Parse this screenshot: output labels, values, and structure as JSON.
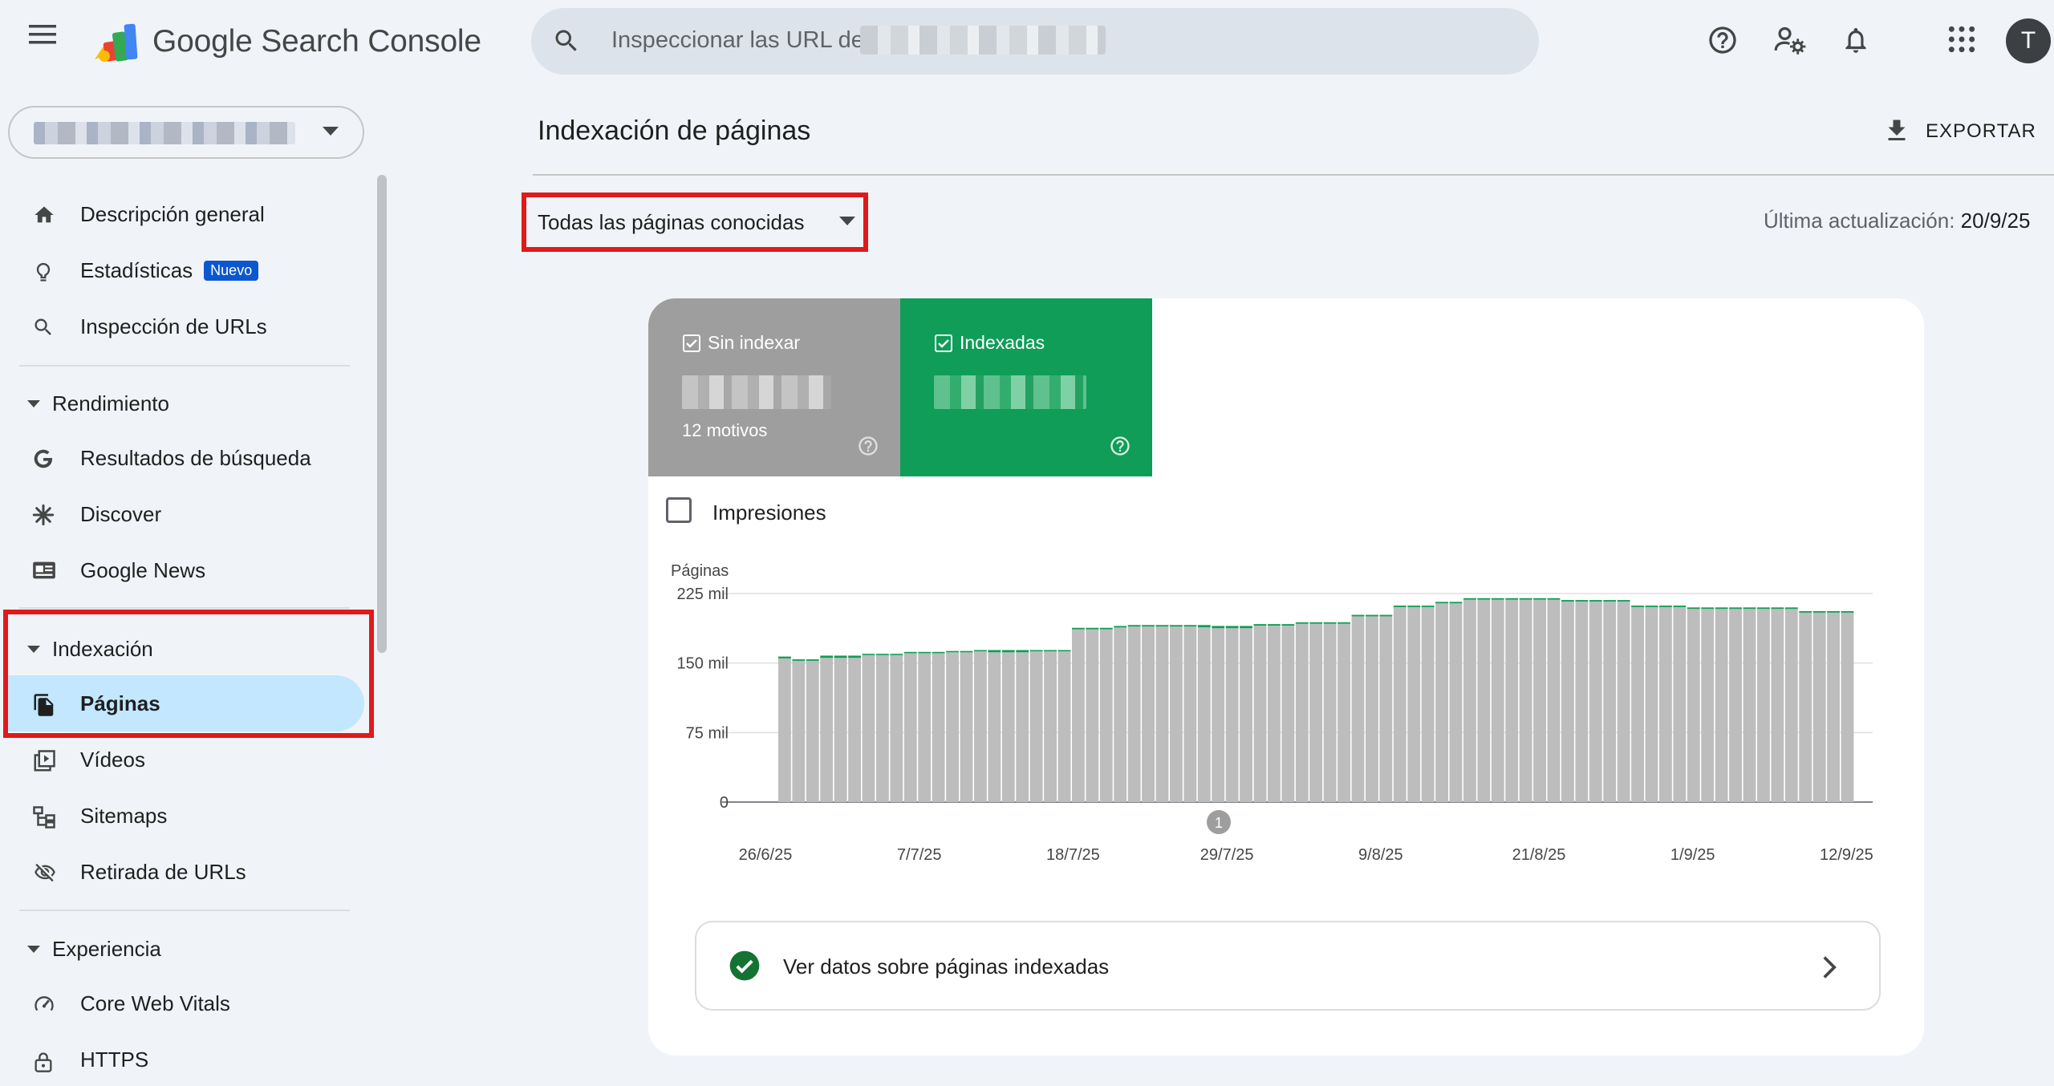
{
  "header": {
    "app_title": "Google Search Console",
    "search_placeholder": "Inspeccionar las URL de",
    "avatar_initial": "T",
    "icons": [
      "menu-icon",
      "search-icon",
      "help-icon",
      "manage-users-icon",
      "notifications-icon",
      "apps-icon"
    ]
  },
  "sidebar": {
    "top_items": [
      {
        "label": "Descripción general",
        "icon": "home-icon"
      },
      {
        "label": "Estadísticas",
        "icon": "lightbulb-icon",
        "badge": "Nuevo"
      },
      {
        "label": "Inspección de URLs",
        "icon": "search-icon"
      }
    ],
    "sections": [
      {
        "label": "Rendimiento",
        "items": [
          {
            "label": "Resultados de búsqueda",
            "icon": "google-g-icon"
          },
          {
            "label": "Discover",
            "icon": "asterisk-icon"
          },
          {
            "label": "Google News",
            "icon": "news-icon"
          }
        ]
      },
      {
        "label": "Indexación",
        "items": [
          {
            "label": "Páginas",
            "icon": "pages-icon",
            "active": true
          },
          {
            "label": "Vídeos",
            "icon": "video-icon"
          },
          {
            "label": "Sitemaps",
            "icon": "sitemap-icon"
          },
          {
            "label": "Retirada de URLs",
            "icon": "eye-off-icon"
          }
        ]
      },
      {
        "label": "Experiencia",
        "items": [
          {
            "label": "Core Web Vitals",
            "icon": "gauge-icon"
          },
          {
            "label": "HTTPS",
            "icon": "lock-icon"
          }
        ]
      }
    ]
  },
  "main": {
    "title": "Indexación de páginas",
    "export_label": "EXPORTAR",
    "filter_value": "Todas las páginas conocidas",
    "updated_label": "Última actualización:",
    "updated_value": "20/9/25",
    "tiles": [
      {
        "label": "Sin indexar",
        "sub": "12 motivos",
        "color": "#9e9e9e"
      },
      {
        "label": "Indexadas",
        "color": "#0f9d58"
      }
    ],
    "impressions_label": "Impresiones",
    "link_label": "Ver datos sobre páginas indexadas"
  },
  "chart_data": {
    "type": "bar",
    "stacked": true,
    "ylabel": "Páginas",
    "yticks": [
      "0",
      "75 mil",
      "150 mil",
      "225 mil"
    ],
    "ylim": [
      0,
      225000
    ],
    "x_tick_labels": [
      "26/6/25",
      "7/7/25",
      "18/7/25",
      "29/7/25",
      "9/8/25",
      "21/8/25",
      "1/9/25",
      "12/9/25"
    ],
    "annotation": "1",
    "series": [
      {
        "name": "Indexadas",
        "color": "#0f9d58"
      },
      {
        "name": "Sin indexar",
        "color": "#bdbdbd"
      }
    ],
    "values": [
      157000,
      154000,
      154000,
      158000,
      158000,
      158000,
      160000,
      160000,
      160000,
      162000,
      162000,
      162000,
      163000,
      163000,
      164000,
      164000,
      164000,
      164000,
      164000,
      164000,
      164000,
      188000,
      188000,
      188000,
      190000,
      191000,
      191000,
      191000,
      191000,
      191000,
      191000,
      190000,
      190000,
      190000,
      192000,
      192000,
      192000,
      194000,
      194000,
      194000,
      194000,
      202000,
      202000,
      202000,
      212000,
      212000,
      212000,
      216000,
      216000,
      220000,
      220000,
      220000,
      220000,
      220000,
      220000,
      220000,
      218000,
      218000,
      218000,
      218000,
      218000,
      212000,
      212000,
      212000,
      212000,
      210000,
      210000,
      210000,
      210000,
      210000,
      210000,
      210000,
      210000,
      206000,
      206000,
      206000,
      206000
    ],
    "indexed_band": [
      2000,
      1600,
      1600,
      2400,
      2400,
      2400,
      1400,
      1400,
      1400,
      1400,
      1400,
      1400,
      1400,
      1400,
      1400,
      2400,
      2400,
      2400,
      1400,
      1400,
      1400,
      1600,
      1600,
      1600,
      1600,
      1600,
      1600,
      1600,
      1600,
      1600,
      2400,
      2400,
      2400,
      2400,
      1600,
      1600,
      1600,
      1600,
      1600,
      1600,
      1600,
      1600,
      1600,
      1600,
      1600,
      1600,
      1600,
      1600,
      1600,
      1600,
      1600,
      1600,
      1600,
      1600,
      1600,
      1600,
      1600,
      1600,
      1600,
      1600,
      1600,
      1600,
      1600,
      1600,
      1600,
      1600,
      1600,
      1600,
      1600,
      1600,
      1600,
      1600,
      1600,
      1600,
      1600,
      1600,
      1600
    ]
  }
}
